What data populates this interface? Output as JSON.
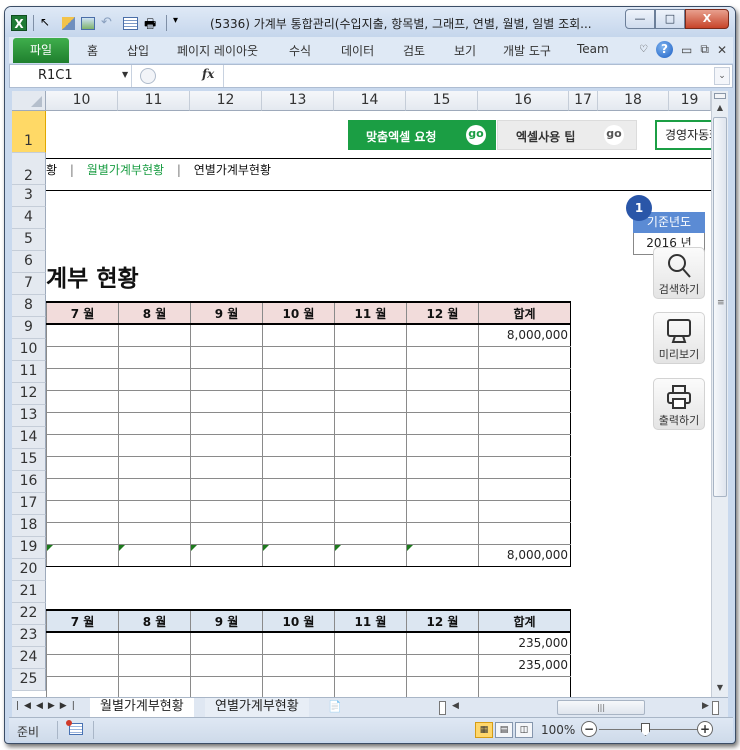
{
  "window": {
    "title": "(5336) 가계부 통합관리(수입지출, 항목별, 그래프, 연별, 월별, 일별 조회...",
    "controls": {
      "minimize": "—",
      "maximize": "□",
      "close": "X"
    }
  },
  "ribbon": {
    "file_tab": "파일",
    "tabs": [
      "홈",
      "삽입",
      "페이지 레이아웃",
      "수식",
      "데이터",
      "검토",
      "보기",
      "개발 도구",
      "Team"
    ]
  },
  "formula_bar": {
    "name_box": "R1C1",
    "fx": "fx",
    "value": ""
  },
  "columns": [
    "10",
    "11",
    "12",
    "13",
    "14",
    "15",
    "16",
    "17",
    "18",
    "19"
  ],
  "rows": [
    "1",
    "2",
    "3",
    "4",
    "5",
    "6",
    "7",
    "8",
    "9",
    "10",
    "11",
    "12",
    "13",
    "14",
    "15",
    "16",
    "17",
    "18",
    "19",
    "20",
    "21",
    "22",
    "23",
    "24",
    "25"
  ],
  "sheet": {
    "buttons": {
      "custom_excel": {
        "label": "맞춤엑셀 요청",
        "go": "go"
      },
      "excel_tip": {
        "label": "엑셀사용 팁",
        "go": "go"
      }
    },
    "auto_box": "경영자동화",
    "nav": {
      "prev_fragment": "황",
      "sep": "|",
      "monthly": "월별가계부현황",
      "yearly": "연별가계부현황"
    },
    "page_title_fragment": "계부 현황",
    "year_selector": {
      "badge": "1",
      "header": "기준년도",
      "value": "2016 년"
    },
    "side_buttons": [
      {
        "label": "검색하기",
        "icon": "search-icon"
      },
      {
        "label": "미리보기",
        "icon": "monitor-icon"
      },
      {
        "label": "출력하기",
        "icon": "printer-icon"
      }
    ],
    "table1": {
      "headers": [
        "7 월",
        "8 월",
        "9 월",
        "10 월",
        "11 월",
        "12 월",
        "합계"
      ],
      "rows": [
        [
          "",
          "",
          "",
          "",
          "",
          "",
          "8,000,000"
        ],
        [
          "",
          "",
          "",
          "",
          "",
          "",
          ""
        ],
        [
          "",
          "",
          "",
          "",
          "",
          "",
          ""
        ],
        [
          "",
          "",
          "",
          "",
          "",
          "",
          ""
        ],
        [
          "",
          "",
          "",
          "",
          "",
          "",
          ""
        ],
        [
          "",
          "",
          "",
          "",
          "",
          "",
          ""
        ],
        [
          "",
          "",
          "",
          "",
          "",
          "",
          ""
        ],
        [
          "",
          "",
          "",
          "",
          "",
          "",
          ""
        ],
        [
          "",
          "",
          "",
          "",
          "",
          "",
          ""
        ],
        [
          "",
          "",
          "",
          "",
          "",
          "",
          ""
        ]
      ],
      "sum_row": [
        "",
        "",
        "",
        "",
        "",
        "",
        "8,000,000"
      ]
    },
    "table2": {
      "headers": [
        "7 월",
        "8 월",
        "9 월",
        "10 월",
        "11 월",
        "12 월",
        "합계"
      ],
      "rows": [
        [
          "",
          "",
          "",
          "",
          "",
          "",
          "235,000"
        ],
        [
          "",
          "",
          "",
          "",
          "",
          "",
          "235,000"
        ],
        [
          "",
          "",
          "",
          "",
          "",
          "",
          ""
        ],
        [
          "",
          "",
          "",
          "",
          "",
          "",
          ""
        ]
      ]
    }
  },
  "sheet_tabs": {
    "active": "월별가계부현황",
    "inactive": "연별가계부현황"
  },
  "status": {
    "ready": "준비",
    "zoom": "100%"
  }
}
